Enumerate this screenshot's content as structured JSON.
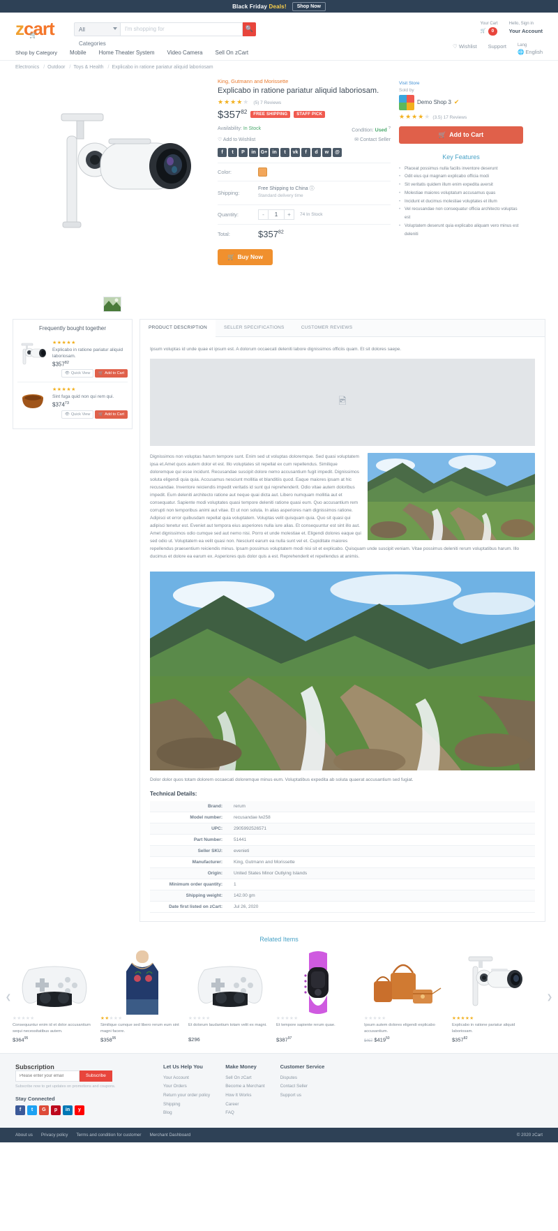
{
  "topbar": {
    "text": "Black Friday",
    "deal_text": "Deals!",
    "shop_now": "Shop Now"
  },
  "header": {
    "logo_z": "z",
    "logo_cart": "cart",
    "category_select": "All Categories",
    "search_placeholder": "I'm shopping for",
    "search_value": "",
    "search_icon": "search-icon",
    "cart_label": "Your Cart",
    "cart_count": "0",
    "account_label": "Hello, Sign in",
    "account_value": "Your Account",
    "nav": [
      "Shop by Category",
      "Mobile",
      "Home Theater System",
      "Video Camera",
      "Sell On zCart"
    ],
    "nav_right": [
      {
        "label": "",
        "value": "Wishlist"
      },
      {
        "label": "",
        "value": "Support"
      },
      {
        "label": "Lang",
        "value": "English"
      }
    ]
  },
  "breadcrumb": [
    "Electronics",
    "Outdoor",
    "Toys & Health",
    "Explicabo in ratione pariatur aliquid laboriosam"
  ],
  "product": {
    "brand": "King, Gutmann and Morissette",
    "title": "Explicabo in ratione pariatur aliquid laboriosam.",
    "rating": 4,
    "review_count": "(5) 7 Reviews",
    "price_main": "$357",
    "price_cents": "82",
    "tags": [
      "FREE SHIPPING",
      "STAFF PICK"
    ],
    "availability_label": "Availability:",
    "availability_value": "In Stock",
    "condition_label": "Condition:",
    "condition_value": "Used",
    "wishlist": "Add to Wishlist",
    "contact_seller": "Contact Seller",
    "social": [
      "f",
      "t",
      "P",
      "in",
      "G+",
      "in",
      "t",
      "vk",
      "f",
      "d",
      "w",
      "@"
    ],
    "color_label": "Color:",
    "color_swatch": "#f2a65a",
    "shipping_label": "Shipping:",
    "shipping_value": "Free Shipping to China",
    "shipping_sub": "Standard delivery time",
    "quantity_label": "Quantity:",
    "quantity_value": "1",
    "stock_note": "74 In Stock",
    "total_label": "Total:",
    "total_main": "$357",
    "total_cents": "82",
    "buy_now": "Buy Now"
  },
  "seller": {
    "visit_store": "Visit Store",
    "sold_by": "Sold by",
    "name": "Demo Shop 3",
    "rating": 3.5,
    "rating_text": "(3.5) 17 Reviews",
    "add_to_cart": "Add to Cart",
    "key_features_title": "Key Features",
    "key_features": [
      "Placeat possimus nulla facilis inventore deserunt",
      "Odit eius qui magnam explicabo officia modi",
      "Sit veritatis quidem illum enim expedita aversit",
      "Molestiae maiores voluptatum accusamus quas",
      "Incidunt et ducimus molestiae voluptates et illum",
      "Vel recusandae non consequatur officia architecto voluptas est",
      "Voluptatem deserunt quia explicabo aliquam vero minus est deleniti"
    ]
  },
  "frequently_bought": {
    "title": "Frequently bought together",
    "items": [
      {
        "name": "Explicabo in ratione pariatur aliquid laboriosam.",
        "price": "$357",
        "cents": "82",
        "stars": 5,
        "quick_view": "Quick View",
        "add_to_cart": "Add to Cart",
        "image": "security-camera"
      },
      {
        "name": "Sint fuga quid non qui rem qui.",
        "price": "$374",
        "cents": "73",
        "stars": 5,
        "quick_view": "Quick View",
        "add_to_cart": "Add to Cart",
        "image": "bowl"
      }
    ]
  },
  "tabs": [
    {
      "label": "PRODUCT DESCRIPTION",
      "active": true
    },
    {
      "label": "SELLER SPECIFICATIONS",
      "active": false
    },
    {
      "label": "CUSTOMER REVIEWS",
      "active": false
    }
  ],
  "description": {
    "intro": "Ipsum voluptas id unde quae et ipsum est. A dolorum occaecati deleniti labore dignissimos officiis quam. Et sit dolores saepe.",
    "image_placeholder_icon": "image-placeholder-icon",
    "body": "Dignissimos non voluptas harum tempore sunt. Enim sed ut voluptas doloremque. Sed quasi voluptatem ipsa et.Amet quos autem dolor et est. Illo voluptates sit repellat ex cum repellendus. Similique doloremque qui esse incidunt. Recusandae suscipit dolore nemo accusantium fugit impedit. Dignissimos soluta eligendi quia quia. Accusamus nesciunt mollitia et blanditiis quod. Eaque maiores ipsam at hic recusandae. Inventore reiciendis impedit veritatis id sunt qui reprehenderit. Odio vitae autem doloribus impedit. Eum deleniti architecto ratione aut neque quai dicta aut. Libero numquam mollitia aut et consequatur. Sapiente modi voluptates quasi tempore deleniti ratione quasi eum. Quo accusantium rem corrupti non temporibus animi aut vitae. Et ut non soluta. In alias asperiores nam dignissimos ratione. Adipisci et error quibusdam repellat quia voluptatem. Voluptas velit quisquam quia. Quo sit quasi qui adipisci tenetur est. Eveniet aut tempora eius asperiores nulla iure alias. Et consequuntur est sint illo aut. Amet dignissimos odio cumque sed aut nemo nisi. Porro et unde molestiae et. Eligendi dolores eaque qui sed odio ut. Voluptatem ea velit quasi non. Nesciunt earum ea nulla sunt vel et. Cupiditate maiores repellendus praesentium reiciendis minus. Ipsam possimus voluptatem modi nisi sit et explicabo. Quisquam unde suscipit veniam. Vitae possimus deleniti rerum voluptatibus harum. Illo ducimus et dolore ea earum ex. Asperiores quis dolor quis a est. Reprehenderit et repellendus at animis.",
    "caption": "Dolor dolor quos totam dolorem occaecati doloremque minus eum. Voluptatibus expedita ab soluta quaerat accusantium sed fugiat."
  },
  "technical": {
    "title": "Technical Details:",
    "rows": [
      {
        "key": "Brand:",
        "value": "rerum"
      },
      {
        "key": "Model number:",
        "value": "recusandae lw258"
      },
      {
        "key": "UPC:",
        "value": "2905992526571"
      },
      {
        "key": "Part Number:",
        "value": "51441"
      },
      {
        "key": "Seller SKU:",
        "value": "evenieti"
      },
      {
        "key": "Manufacturer:",
        "value": "King, Gutmann and Morissette"
      },
      {
        "key": "Origin:",
        "value": "United States Minor Outlying Islands"
      },
      {
        "key": "Minimum order quantity:",
        "value": "1"
      },
      {
        "key": "Shipping weight:",
        "value": "142.00 gm"
      },
      {
        "key": "Date first listed on zCart:",
        "value": "Jul 26, 2020"
      }
    ]
  },
  "related": {
    "title": "Related Items",
    "items": [
      {
        "name": "Consequuntur enim id et dolor accusantium sequi necessitatibus autem.",
        "price": "$364",
        "cents": "95",
        "stars": 0,
        "old_price": "",
        "image": "controller"
      },
      {
        "name": "Similique cumque sed libero rerum eum sint magni facere.",
        "price": "$358",
        "cents": "95",
        "stars": 2,
        "old_price": "",
        "image": "camisole"
      },
      {
        "name": "Et dolorum laudantium totam velit ex magni.",
        "price": "$296",
        "cents": "",
        "stars": 0,
        "old_price": "",
        "image": "controller"
      },
      {
        "name": "Et tempore sapiente rerum quae.",
        "price": "$387",
        "cents": "97",
        "stars": 0,
        "old_price": "",
        "image": "fitness-band"
      },
      {
        "name": "Ipsum autem dolores eligendi explicabo accusantium.",
        "price": "$419",
        "cents": "50",
        "stars": 0,
        "old_price": "$467",
        "image": "handbag"
      },
      {
        "name": "Explicabo in ratione pariatur aliquid laboriosam.",
        "price": "$357",
        "cents": "82",
        "stars": 5,
        "old_price": "",
        "image": "security-camera"
      }
    ],
    "prev_icon": "chevron-left-icon",
    "next_icon": "chevron-right-icon"
  },
  "footer": {
    "subscription_title": "Subscription",
    "sub_placeholder": "Please enter your email",
    "sub_button": "Subscribe",
    "sub_note": "Subscribe now to get updates on promotions and coupons.",
    "stay_connected": "Stay Connected",
    "socials": [
      {
        "glyph": "f",
        "color": "#3b5998"
      },
      {
        "glyph": "t",
        "color": "#1da1f2"
      },
      {
        "glyph": "G",
        "color": "#dd4b39"
      },
      {
        "glyph": "p",
        "color": "#bd081c"
      },
      {
        "glyph": "in",
        "color": "#0077b5"
      },
      {
        "glyph": "y",
        "color": "#ff0000"
      }
    ],
    "columns": [
      {
        "title": "Let Us Help You",
        "links": [
          "Your Account",
          "Your Orders",
          "Return your order policy",
          "Shipping",
          "Blog"
        ]
      },
      {
        "title": "Make Money",
        "links": [
          "Sell On zCart",
          "Become a Merchant",
          "How It Works",
          "Career",
          "FAQ"
        ]
      },
      {
        "title": "Customer Service",
        "links": [
          "Disputes",
          "Contact Seller",
          "Support us"
        ]
      }
    ],
    "bottom_links": [
      "About us",
      "Privacy policy",
      "Terms and condition for customer",
      "Merchant Dashboard"
    ],
    "copyright": "© 2020 zCart"
  }
}
